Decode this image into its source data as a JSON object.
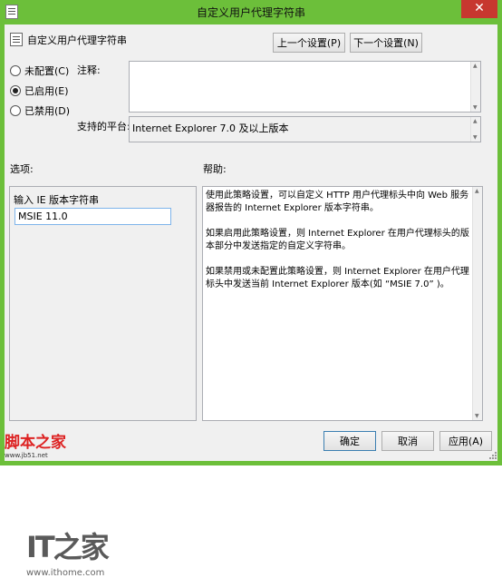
{
  "window": {
    "title": "自定义用户代理字符串",
    "close_glyph": "✕",
    "accent_color": "#6cbf3a",
    "close_color": "#c7372f"
  },
  "header": {
    "setting_name": "自定义用户代理字符串",
    "prev_button": "上一个设置(P)",
    "next_button": "下一个设置(N)"
  },
  "state": {
    "options": [
      {
        "label": "未配置(C)",
        "selected": false
      },
      {
        "label": "已启用(E)",
        "selected": true
      },
      {
        "label": "已禁用(D)",
        "selected": false
      }
    ]
  },
  "comment": {
    "label": "注释:",
    "value": ""
  },
  "platform": {
    "label": "支持的平台:",
    "value": "Internet Explorer 7.0 及以上版本"
  },
  "options_pane": {
    "heading": "选项:",
    "field_label": "输入 IE 版本字符串",
    "field_value": "MSIE 11.0"
  },
  "help_pane": {
    "heading": "帮助:",
    "paragraphs": [
      "使用此策略设置，可以自定义 HTTP 用户代理标头中向 Web 服务器报告的 Internet Explorer 版本字符串。",
      "如果启用此策略设置，则 Internet Explorer 在用户代理标头的版本部分中发送指定的自定义字符串。",
      "如果禁用或未配置此策略设置，则 Internet Explorer 在用户代理标头中发送当前 Internet Explorer 版本(如 “MSIE 7.0” )。"
    ]
  },
  "watermark": {
    "logo": "IT之家",
    "url": "www.ithome.com"
  },
  "site_logo": {
    "name": "脚本之家",
    "url": "www.jb51.net"
  },
  "footer": {
    "ok_button": "确定",
    "cancel_button": "取消",
    "apply_button": "应用(A)"
  }
}
